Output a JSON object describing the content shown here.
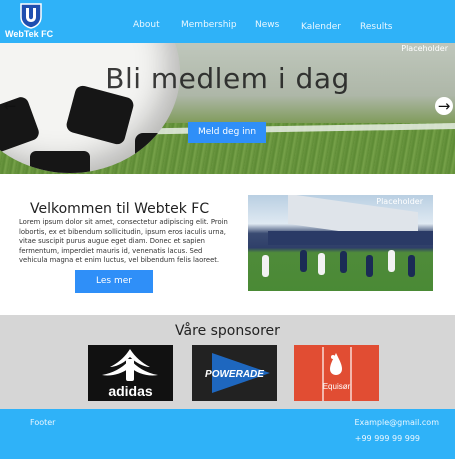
{
  "brand": {
    "name": "WebTek FC"
  },
  "nav": {
    "items": [
      {
        "label": "About"
      },
      {
        "label": "Membership"
      },
      {
        "label": "News"
      },
      {
        "label": "Kalender"
      },
      {
        "label": "Results"
      }
    ]
  },
  "hero": {
    "placeholder": "Placeholder",
    "title": "Bli medlem i dag",
    "button": "Meld deg inn",
    "prev_icon": "arrow-left-icon",
    "next_icon": "arrow-right-icon"
  },
  "welcome": {
    "title": "Velkommen til Webtek FC",
    "body": "Lorem ipsum dolor sit amet, consectetur adipiscing elit. Proin lobortis, ex et bibendum sollicitudin, ipsum eros iaculis urna, vitae suscipit purus augue eget diam. Donec et sapien fermentum, imperdiet mauris id, venenatis lacus. Sed vehicula magna et enim luctus, vel bibendum felis laoreet.",
    "button": "Les mer",
    "image_placeholder": "Placeholder"
  },
  "sponsors": {
    "title": "Våre sponsorer",
    "items": [
      {
        "name": "adidas",
        "bg": "#111111"
      },
      {
        "name": "POWERADE",
        "bg": "#222222"
      },
      {
        "name": "Equisør",
        "bg": "#e14d33"
      }
    ]
  },
  "footer": {
    "label": "Footer",
    "email": "Example@gmail.com",
    "phone": "+99 999 99 999"
  },
  "colors": {
    "primary": "#2fb2f8",
    "button": "#2f8ff8",
    "sponsor_bg": "#d6d6d6"
  }
}
